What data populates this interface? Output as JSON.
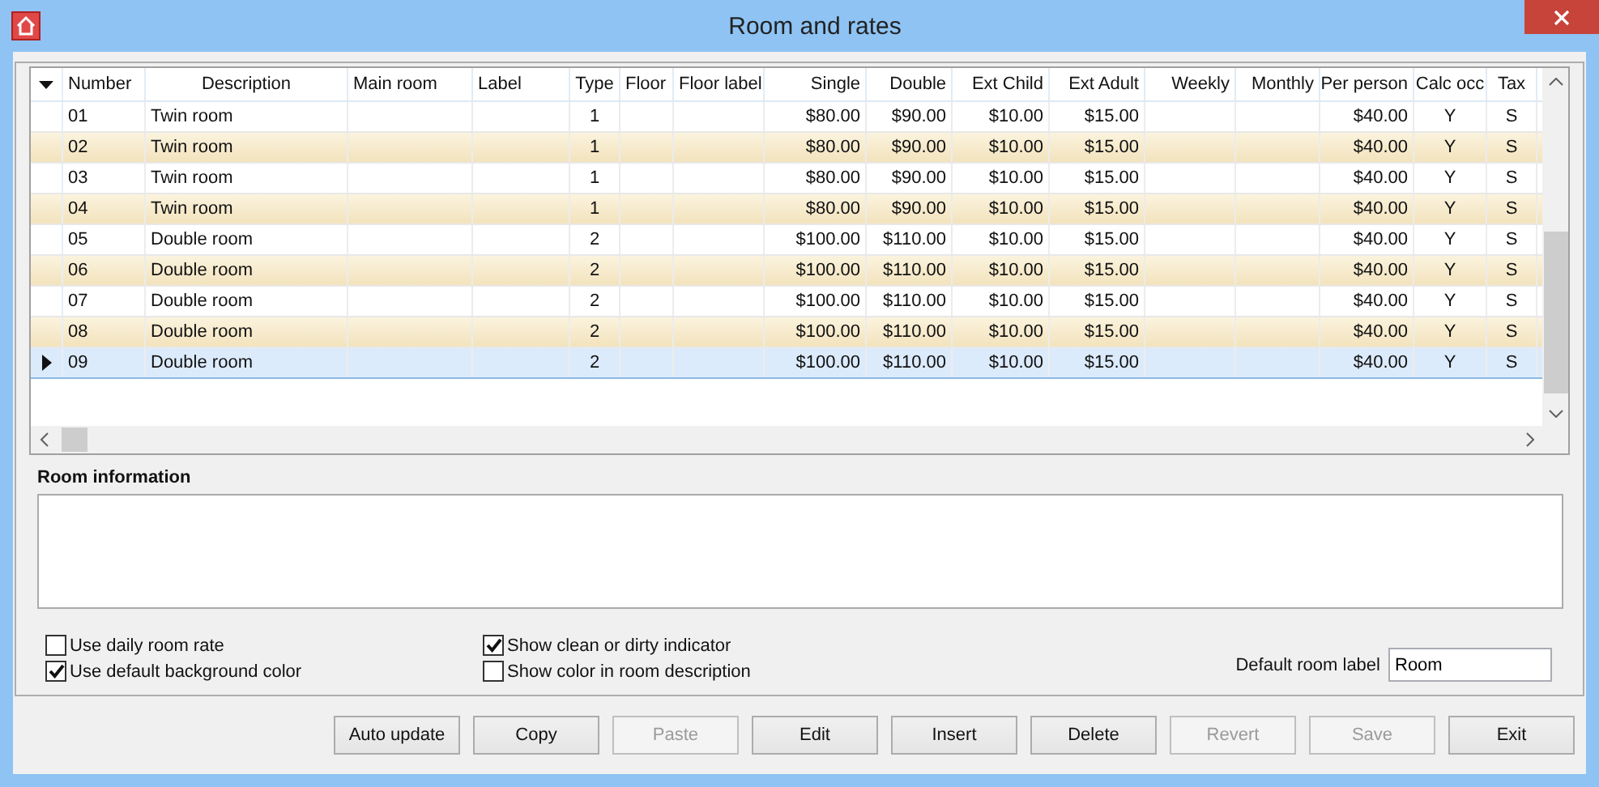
{
  "window": {
    "title": "Room and rates"
  },
  "table": {
    "columns": [
      "Number",
      "Description",
      "Main room",
      "Label",
      "Type",
      "Floor",
      "Floor label",
      "Single",
      "Double",
      "Ext Child",
      "Ext Adult",
      "Weekly",
      "Monthly",
      "Per person",
      "Calc occ",
      "Tax"
    ],
    "rows": [
      {
        "selected": false,
        "cells": [
          "01",
          "Twin room",
          "",
          "",
          "1",
          "",
          "",
          "$80.00",
          "$90.00",
          "$10.00",
          "$15.00",
          "",
          "",
          "$40.00",
          "Y",
          "S"
        ]
      },
      {
        "selected": false,
        "cells": [
          "02",
          "Twin room",
          "",
          "",
          "1",
          "",
          "",
          "$80.00",
          "$90.00",
          "$10.00",
          "$15.00",
          "",
          "",
          "$40.00",
          "Y",
          "S"
        ]
      },
      {
        "selected": false,
        "cells": [
          "03",
          "Twin room",
          "",
          "",
          "1",
          "",
          "",
          "$80.00",
          "$90.00",
          "$10.00",
          "$15.00",
          "",
          "",
          "$40.00",
          "Y",
          "S"
        ]
      },
      {
        "selected": false,
        "cells": [
          "04",
          "Twin room",
          "",
          "",
          "1",
          "",
          "",
          "$80.00",
          "$90.00",
          "$10.00",
          "$15.00",
          "",
          "",
          "$40.00",
          "Y",
          "S"
        ]
      },
      {
        "selected": false,
        "cells": [
          "05",
          "Double room",
          "",
          "",
          "2",
          "",
          "",
          "$100.00",
          "$110.00",
          "$10.00",
          "$15.00",
          "",
          "",
          "$40.00",
          "Y",
          "S"
        ]
      },
      {
        "selected": false,
        "cells": [
          "06",
          "Double room",
          "",
          "",
          "2",
          "",
          "",
          "$100.00",
          "$110.00",
          "$10.00",
          "$15.00",
          "",
          "",
          "$40.00",
          "Y",
          "S"
        ]
      },
      {
        "selected": false,
        "cells": [
          "07",
          "Double room",
          "",
          "",
          "2",
          "",
          "",
          "$100.00",
          "$110.00",
          "$10.00",
          "$15.00",
          "",
          "",
          "$40.00",
          "Y",
          "S"
        ]
      },
      {
        "selected": false,
        "cells": [
          "08",
          "Double room",
          "",
          "",
          "2",
          "",
          "",
          "$100.00",
          "$110.00",
          "$10.00",
          "$15.00",
          "",
          "",
          "$40.00",
          "Y",
          "S"
        ]
      },
      {
        "selected": true,
        "cells": [
          "09",
          "Double room",
          "",
          "",
          "2",
          "",
          "",
          "$100.00",
          "$110.00",
          "$10.00",
          "$15.00",
          "",
          "",
          "$40.00",
          "Y",
          "S"
        ]
      }
    ]
  },
  "room_information": {
    "label": "Room information"
  },
  "options": [
    {
      "label": "Use daily room rate",
      "checked": false
    },
    {
      "label": "Use default background color",
      "checked": true
    },
    {
      "label": "Show clean or dirty indicator",
      "checked": true
    },
    {
      "label": "Show color in room description",
      "checked": false
    }
  ],
  "default_room_label": {
    "label": "Default room label",
    "value": "Room"
  },
  "buttons": [
    {
      "label": "Auto update",
      "disabled": false
    },
    {
      "label": "Copy",
      "disabled": false
    },
    {
      "label": "Paste",
      "disabled": true
    },
    {
      "label": "Edit",
      "disabled": false
    },
    {
      "label": "Insert",
      "disabled": false
    },
    {
      "label": "Delete",
      "disabled": false
    },
    {
      "label": "Revert",
      "disabled": true
    },
    {
      "label": "Save",
      "disabled": true
    },
    {
      "label": "Exit",
      "disabled": false
    }
  ]
}
